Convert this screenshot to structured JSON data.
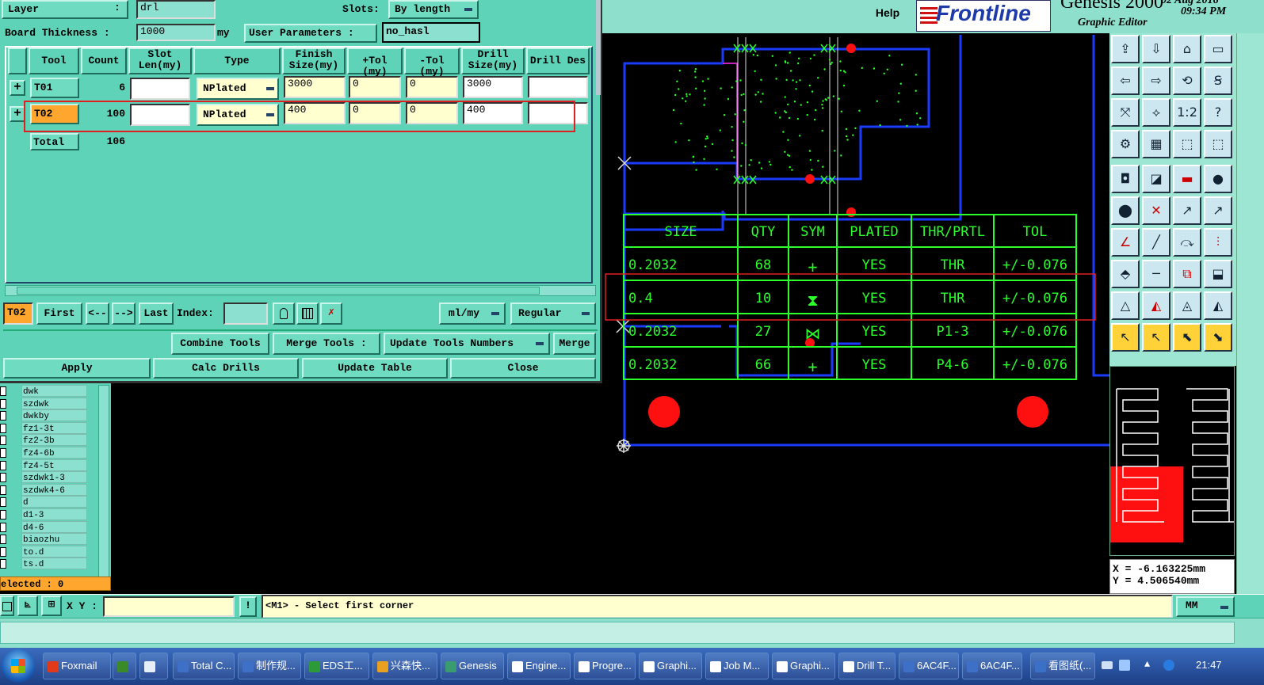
{
  "header": {
    "layer_label": "Layer",
    "layer_value": "drl",
    "slots_label": "Slots:",
    "slots_value": "By length",
    "board_thickness_label": "Board Thickness :",
    "board_thickness_value": "1000",
    "board_thickness_unit": "my",
    "user_params_label": "User Parameters :",
    "user_params_value": "no_hasl",
    "help_label": "Help",
    "brand": "Frontline",
    "app_name": "Genesis 2000",
    "date": "02 Aug 2016",
    "time": "09:34 PM",
    "editor_label": "Graphic Editor"
  },
  "tool_table": {
    "columns": [
      "Tool",
      "Count",
      "Slot Len(my)",
      "Type",
      "Finish Size(my)",
      "+Tol (my)",
      "-Tol (my)",
      "Drill Size(my)",
      "Drill Des"
    ],
    "rows": [
      {
        "tool": "T01",
        "count": "6",
        "slot_len": "",
        "type": "NPlated",
        "finish": "3000",
        "plus_tol": "0",
        "minus_tol": "0",
        "drill": "3000",
        "des": ""
      },
      {
        "tool": "T02",
        "count": "100",
        "slot_len": "",
        "type": "NPlated",
        "finish": "400",
        "plus_tol": "0",
        "minus_tol": "0",
        "drill": "400",
        "des": ""
      }
    ],
    "total_label": "Total",
    "total_count": "106"
  },
  "nav": {
    "current": "T02",
    "first": "First",
    "prev": "<--",
    "next": "-->",
    "last": "Last",
    "index_label": "Index:",
    "units": "ml/my",
    "mode": "Regular"
  },
  "actions": {
    "combine": "Combine Tools",
    "merge_tools": "Merge Tools :",
    "update_numbers": "Update Tools Numbers",
    "merge": "Merge",
    "apply": "Apply",
    "calc": "Calc Drills",
    "update_table": "Update Table",
    "close": "Close"
  },
  "layer_list": {
    "items": [
      "dwk",
      "szdwk",
      "dwkby",
      "fz1-3t",
      "fz2-3b",
      "fz4-6b",
      "fz4-5t",
      "szdwk1-3",
      "szdwk4-6",
      "d",
      "d1-3",
      "d4-6",
      "biaozhu",
      "to.d",
      "ts.d"
    ],
    "selected_label": "elected : 0"
  },
  "status": {
    "xy_label": "X Y :",
    "xy_value": "",
    "message": "<M1> - Select first corner",
    "units": "MM"
  },
  "coords": {
    "x": "X = -6.163225mm",
    "y": "Y = 4.506540mm"
  },
  "drill_chart": {
    "headers": [
      "SIZE",
      "QTY",
      "SYM",
      "PLATED",
      "THR/PRTL",
      "TOL"
    ],
    "rows": [
      [
        "0.2032",
        "68",
        "+",
        "YES",
        "THR",
        "+/-0.076"
      ],
      [
        "0.4",
        "10",
        "⧗",
        "YES",
        "THR",
        "+/-0.076"
      ],
      [
        "0.2032",
        "27",
        "⋈",
        "YES",
        "P1-3",
        "+/-0.076"
      ],
      [
        "0.2032",
        "66",
        "+",
        "YES",
        "P4-6",
        "+/-0.076"
      ]
    ]
  },
  "taskbar": {
    "items": [
      "Foxmail",
      "",
      "",
      "Total C...",
      "制作规...",
      "EDS工...",
      "兴森快...",
      "Genesis",
      "Engine...",
      "Progre...",
      "Graphi...",
      "Job M...",
      "Graphi...",
      "Drill T...",
      "6AC4F...",
      "6AC4F...",
      "看图纸(..."
    ],
    "clock": "21:47"
  },
  "colors": {
    "panel": "#5fd3b8",
    "highlight_box": "#e02020",
    "canvas_line": "#1a3cff",
    "chart_green": "#2aff2a",
    "pad_red": "#ff1010"
  }
}
